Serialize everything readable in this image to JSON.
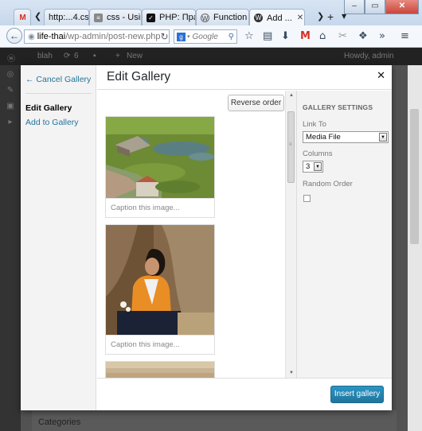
{
  "browser": {
    "tabs": [
      {
        "label": "http:...4.css",
        "favicon": "gmail-icon"
      },
      {
        "label": "css - Usin...",
        "favicon": "stackoverflow-icon"
      },
      {
        "label": "PHP: Пра...",
        "favicon": "check-icon"
      },
      {
        "label": "Function ...",
        "favicon": "wordpress-icon"
      },
      {
        "label": "Add ...",
        "favicon": "wordpress-icon",
        "active": true
      }
    ],
    "url_host": "life-thai",
    "url_path": "/wp-admin/post-new.php",
    "search_placeholder": "Google"
  },
  "wp_bg": {
    "site_name": "blah",
    "updates": "6",
    "new_label": "New",
    "howdy": "Howdy, admin",
    "categories": "Categories"
  },
  "modal": {
    "menu": {
      "cancel": "← Cancel Gallery",
      "edit_gallery": "Edit Gallery",
      "add_to_gallery": "Add to Gallery"
    },
    "title": "Edit Gallery",
    "reverse_order": "Reverse order",
    "attachments": [
      {
        "caption_placeholder": "Caption this image..."
      },
      {
        "caption_placeholder": "Caption this image..."
      },
      {
        "caption_placeholder": ""
      }
    ],
    "settings": {
      "heading": "GALLERY SETTINGS",
      "link_to_label": "Link To",
      "link_to_value": "Media File",
      "columns_label": "Columns",
      "columns_value": "3",
      "random_order_label": "Random Order",
      "random_order_checked": false
    },
    "insert_button": "Insert gallery"
  },
  "colors": {
    "accent_link": "#21759b",
    "primary_button": "#2a95c5"
  }
}
